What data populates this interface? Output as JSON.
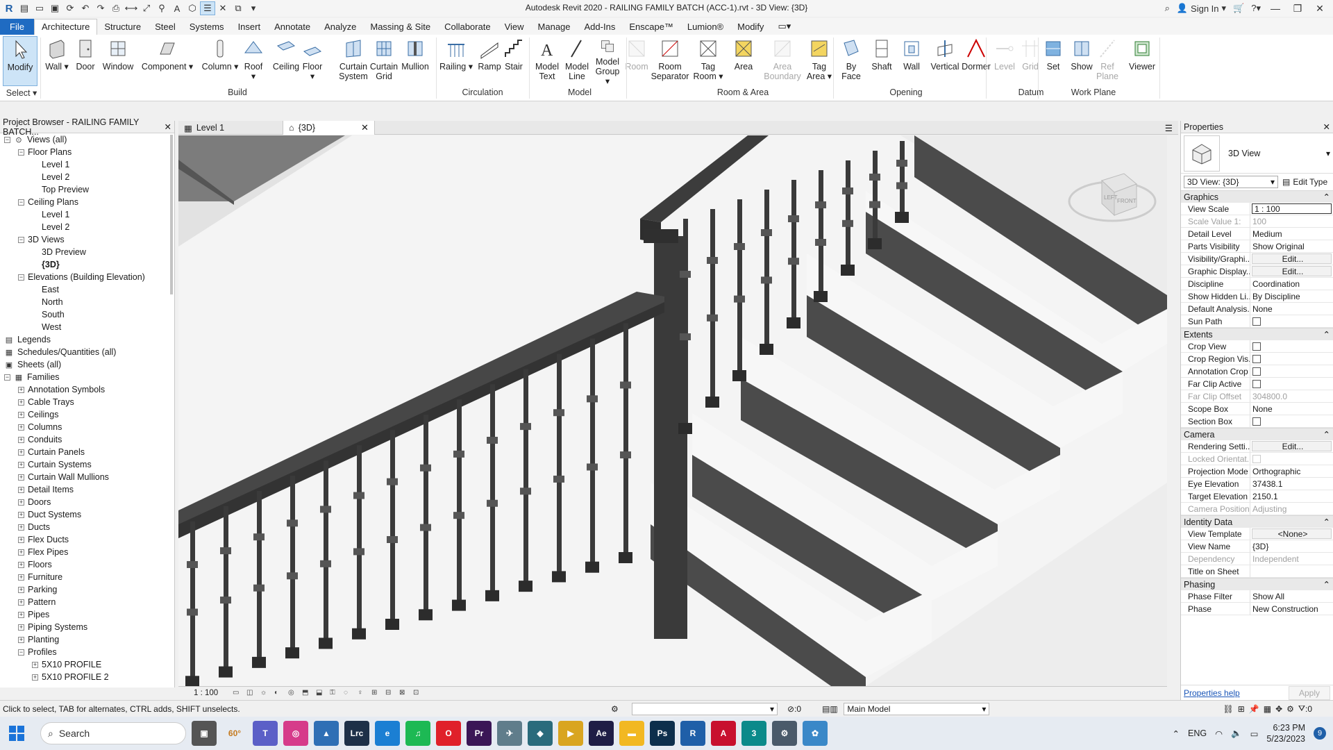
{
  "window": {
    "title": "Autodesk Revit 2020 - RAILING FAMILY BATCH (ACC-1).rvt - 3D View: {3D}",
    "sign_in": "Sign In"
  },
  "ribbon_tabs": [
    "File",
    "Architecture",
    "Structure",
    "Steel",
    "Systems",
    "Insert",
    "Annotate",
    "Analyze",
    "Massing & Site",
    "Collaborate",
    "View",
    "Manage",
    "Add-Ins",
    "Enscape™",
    "Lumion®",
    "Modify"
  ],
  "ribbon": {
    "select_label": "Select",
    "buttons": [
      {
        "label": "Modify",
        "icon": "cursor-icon"
      },
      {
        "label": "Wall",
        "icon": "wall-icon"
      },
      {
        "label": "Door",
        "icon": "door-icon"
      },
      {
        "label": "Window",
        "icon": "window-icon"
      },
      {
        "label": "Component",
        "icon": "component-icon"
      },
      {
        "label": "Column",
        "icon": "column-icon"
      },
      {
        "label": "Roof",
        "icon": "roof-icon"
      },
      {
        "label": "Ceiling",
        "icon": "ceiling-icon"
      },
      {
        "label": "Floor",
        "icon": "floor-icon"
      },
      {
        "label": "Curtain System",
        "icon": "curtain-system-icon"
      },
      {
        "label": "Curtain Grid",
        "icon": "curtain-grid-icon"
      },
      {
        "label": "Mullion",
        "icon": "mullion-icon"
      },
      {
        "label": "Railing",
        "icon": "railing-icon"
      },
      {
        "label": "Ramp",
        "icon": "ramp-icon"
      },
      {
        "label": "Stair",
        "icon": "stair-icon"
      },
      {
        "label": "Model Text",
        "icon": "model-text-icon"
      },
      {
        "label": "Model Line",
        "icon": "model-line-icon"
      },
      {
        "label": "Model Group",
        "icon": "model-group-icon"
      },
      {
        "label": "Room",
        "icon": "room-icon"
      },
      {
        "label": "Room Separator",
        "icon": "room-separator-icon"
      },
      {
        "label": "Tag Room",
        "icon": "tag-room-icon"
      },
      {
        "label": "Area",
        "icon": "area-icon"
      },
      {
        "label": "Area Boundary",
        "icon": "area-boundary-icon"
      },
      {
        "label": "Tag Area",
        "icon": "tag-area-icon"
      },
      {
        "label": "By Face",
        "icon": "by-face-icon"
      },
      {
        "label": "Shaft",
        "icon": "shaft-icon"
      },
      {
        "label": "Wall",
        "icon": "wall-opening-icon"
      },
      {
        "label": "Vertical",
        "icon": "vertical-icon"
      },
      {
        "label": "Dormer",
        "icon": "dormer-icon"
      },
      {
        "label": "Level",
        "icon": "level-icon"
      },
      {
        "label": "Grid",
        "icon": "grid-icon"
      },
      {
        "label": "Set",
        "icon": "set-icon"
      },
      {
        "label": "Show",
        "icon": "show-icon"
      },
      {
        "label": "Ref Plane",
        "icon": "ref-plane-icon"
      },
      {
        "label": "Viewer",
        "icon": "viewer-icon"
      }
    ],
    "panels": [
      "Build",
      "Circulation",
      "Model",
      "Room & Area",
      "Opening",
      "Datum",
      "Work Plane"
    ]
  },
  "project_browser": {
    "title": "Project Browser - RAILING FAMILY BATCH...",
    "nodes": [
      {
        "label": "Views (all)",
        "toggle": "−"
      },
      {
        "label": "Floor Plans",
        "toggle": "−"
      },
      {
        "label": "Level 1"
      },
      {
        "label": "Level 2"
      },
      {
        "label": "Top Preview"
      },
      {
        "label": "Ceiling Plans",
        "toggle": "−"
      },
      {
        "label": "Level 1"
      },
      {
        "label": "Level 2"
      },
      {
        "label": "3D Views",
        "toggle": "−"
      },
      {
        "label": "3D Preview"
      },
      {
        "label": "{3D}"
      },
      {
        "label": "Elevations (Building Elevation)",
        "toggle": "−"
      },
      {
        "label": "East"
      },
      {
        "label": "North"
      },
      {
        "label": "South"
      },
      {
        "label": "West"
      },
      {
        "label": "Legends"
      },
      {
        "label": "Schedules/Quantities (all)"
      },
      {
        "label": "Sheets (all)"
      },
      {
        "label": "Families",
        "toggle": "−"
      },
      {
        "label": "Annotation Symbols",
        "toggle": "+"
      },
      {
        "label": "Cable Trays",
        "toggle": "+"
      },
      {
        "label": "Ceilings",
        "toggle": "+"
      },
      {
        "label": "Columns",
        "toggle": "+"
      },
      {
        "label": "Conduits",
        "toggle": "+"
      },
      {
        "label": "Curtain Panels",
        "toggle": "+"
      },
      {
        "label": "Curtain Systems",
        "toggle": "+"
      },
      {
        "label": "Curtain Wall Mullions",
        "toggle": "+"
      },
      {
        "label": "Detail Items",
        "toggle": "+"
      },
      {
        "label": "Doors",
        "toggle": "+"
      },
      {
        "label": "Duct Systems",
        "toggle": "+"
      },
      {
        "label": "Ducts",
        "toggle": "+"
      },
      {
        "label": "Flex Ducts",
        "toggle": "+"
      },
      {
        "label": "Flex Pipes",
        "toggle": "+"
      },
      {
        "label": "Floors",
        "toggle": "+"
      },
      {
        "label": "Furniture",
        "toggle": "+"
      },
      {
        "label": "Parking",
        "toggle": "+"
      },
      {
        "label": "Pattern",
        "toggle": "+"
      },
      {
        "label": "Pipes",
        "toggle": "+"
      },
      {
        "label": "Piping Systems",
        "toggle": "+"
      },
      {
        "label": "Planting",
        "toggle": "+"
      },
      {
        "label": "Profiles",
        "toggle": "−"
      },
      {
        "label": "5X10 PROFILE",
        "toggle": "+"
      },
      {
        "label": "5X10 PROFILE 2",
        "toggle": "+"
      }
    ]
  },
  "view_tabs": [
    {
      "label": "Level 1"
    },
    {
      "label": "{3D}"
    }
  ],
  "viewcube": {
    "left": "LEFT",
    "front": "FRONT"
  },
  "view_control": {
    "scale": "1 : 100"
  },
  "properties": {
    "title": "Properties",
    "type_name": "3D View",
    "filter": "3D View: {3D}",
    "edit_type": "Edit Type",
    "groups": [
      {
        "name": "Graphics",
        "rows": [
          {
            "name": "View Scale",
            "value": "1 : 100",
            "style": "boxed"
          },
          {
            "name": "Scale Value    1:",
            "value": "100",
            "dim": true
          },
          {
            "name": "Detail Level",
            "value": "Medium"
          },
          {
            "name": "Parts Visibility",
            "value": "Show Original"
          },
          {
            "name": "Visibility/Graphi...",
            "value": "Edit...",
            "style": "btn"
          },
          {
            "name": "Graphic Display...",
            "value": "Edit...",
            "style": "btn"
          },
          {
            "name": "Discipline",
            "value": "Coordination"
          },
          {
            "name": "Show Hidden Li...",
            "value": "By Discipline"
          },
          {
            "name": "Default Analysis...",
            "value": "None"
          },
          {
            "name": "Sun Path",
            "value": "",
            "style": "check"
          }
        ]
      },
      {
        "name": "Extents",
        "rows": [
          {
            "name": "Crop View",
            "value": "",
            "style": "check"
          },
          {
            "name": "Crop Region Vis...",
            "value": "",
            "style": "check"
          },
          {
            "name": "Annotation Crop",
            "value": "",
            "style": "check"
          },
          {
            "name": "Far Clip Active",
            "value": "",
            "style": "check"
          },
          {
            "name": "Far Clip Offset",
            "value": "304800.0",
            "dim": true
          },
          {
            "name": "Scope Box",
            "value": "None"
          },
          {
            "name": "Section Box",
            "value": "",
            "style": "check"
          }
        ]
      },
      {
        "name": "Camera",
        "rows": [
          {
            "name": "Rendering Setti...",
            "value": "Edit...",
            "style": "btn"
          },
          {
            "name": "Locked Orientat...",
            "value": "",
            "style": "check",
            "dim": true
          },
          {
            "name": "Projection Mode",
            "value": "Orthographic"
          },
          {
            "name": "Eye Elevation",
            "value": "37438.1"
          },
          {
            "name": "Target Elevation",
            "value": "2150.1"
          },
          {
            "name": "Camera Position",
            "value": "Adjusting",
            "dim": true
          }
        ]
      },
      {
        "name": "Identity Data",
        "rows": [
          {
            "name": "View Template",
            "value": "<None>",
            "style": "btn"
          },
          {
            "name": "View Name",
            "value": "{3D}"
          },
          {
            "name": "Dependency",
            "value": "Independent",
            "dim": true
          },
          {
            "name": "Title on Sheet",
            "value": ""
          }
        ]
      },
      {
        "name": "Phasing",
        "rows": [
          {
            "name": "Phase Filter",
            "value": "Show All"
          },
          {
            "name": "Phase",
            "value": "New Construction"
          }
        ]
      }
    ],
    "help": "Properties help",
    "apply": "Apply"
  },
  "status": {
    "text": "Click to select, TAB for alternates, CTRL adds, SHIFT unselects.",
    "counter": ":0",
    "model": "Main Model",
    "filter_count": ":0"
  },
  "taskbar": {
    "search": "Search",
    "lang": "ENG",
    "time": "6:23 PM",
    "date": "5/23/2023",
    "notifications": "9",
    "weather": "60°"
  }
}
